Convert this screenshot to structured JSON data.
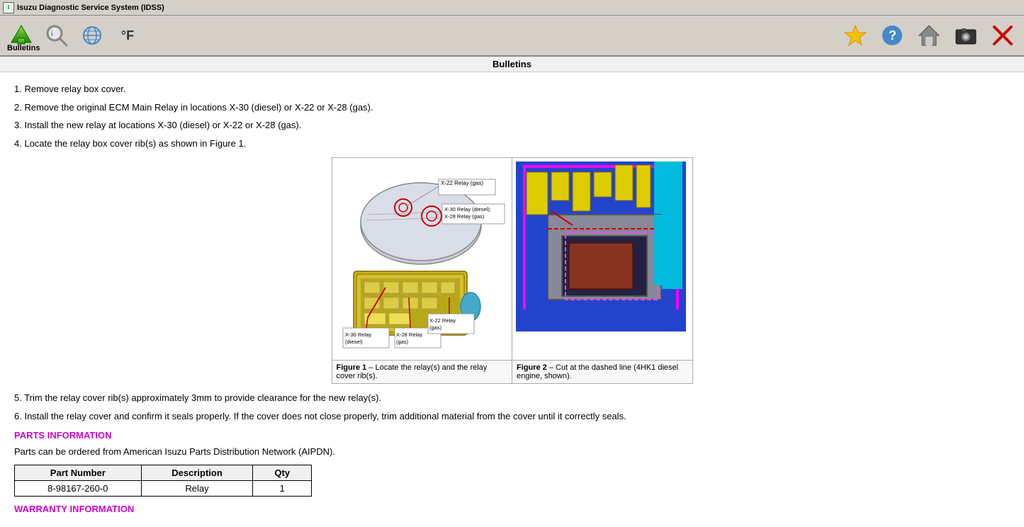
{
  "titlebar": {
    "label": "Isuzu Diagnostic Service System (IDSS)"
  },
  "toolbar": {
    "label": "Bulletins",
    "buttons": [
      {
        "name": "back-button",
        "label": "↓",
        "title": "Back"
      },
      {
        "name": "search-button",
        "label": "🔍",
        "title": "Search"
      },
      {
        "name": "network-button",
        "label": "🌐",
        "title": "Network"
      },
      {
        "name": "temp-button",
        "label": "°F",
        "title": "Temperature"
      }
    ],
    "right_buttons": [
      {
        "name": "favorites-button",
        "label": "★",
        "title": "Favorites"
      },
      {
        "name": "help-button",
        "label": "?",
        "title": "Help"
      },
      {
        "name": "home-button",
        "label": "⌂",
        "title": "Home"
      },
      {
        "name": "screenshot-button",
        "label": "📷",
        "title": "Screenshot"
      },
      {
        "name": "close-button",
        "label": "✕",
        "title": "Close"
      }
    ]
  },
  "header": {
    "title": "Bulletins"
  },
  "content": {
    "steps": [
      {
        "number": "1.",
        "text": "Remove relay box cover."
      },
      {
        "number": "2.",
        "text": "Remove the original ECM Main Relay in locations X-30 (diesel) or X-22 or X-28 (gas)."
      },
      {
        "number": "3.",
        "text": "Install the new relay at locations X-30 (diesel) or X-22 or X-28 (gas)."
      },
      {
        "number": "4.",
        "text": "Locate the relay box cover rib(s) as shown in Figure 1."
      },
      {
        "number": "5.",
        "text": "Trim the relay cover rib(s) approximately 3mm to provide clearance for the new relay(s)."
      },
      {
        "number": "6.",
        "text": "Install the relay cover and confirm it seals properly. If the cover does not close properly, trim additional material from the cover until it correctly seals."
      }
    ],
    "figure1_caption": "Figure 1 – Locate the relay(s) and the relay cover rib(s).",
    "figure2_caption": "Figure 2 – Cut at the dashed line (4HK1 diesel engine, shown).",
    "parts_section": {
      "heading": "PARTS INFORMATION",
      "description": "Parts can be ordered from American Isuzu Parts Distribution Network (AIPDN).",
      "table": {
        "headers": [
          "Part Number",
          "Description",
          "Qty"
        ],
        "rows": [
          [
            "8-98167-260-0",
            "Relay",
            "1"
          ]
        ]
      }
    },
    "warranty_section": {
      "heading": "WARRANTY INFORMATION"
    }
  }
}
